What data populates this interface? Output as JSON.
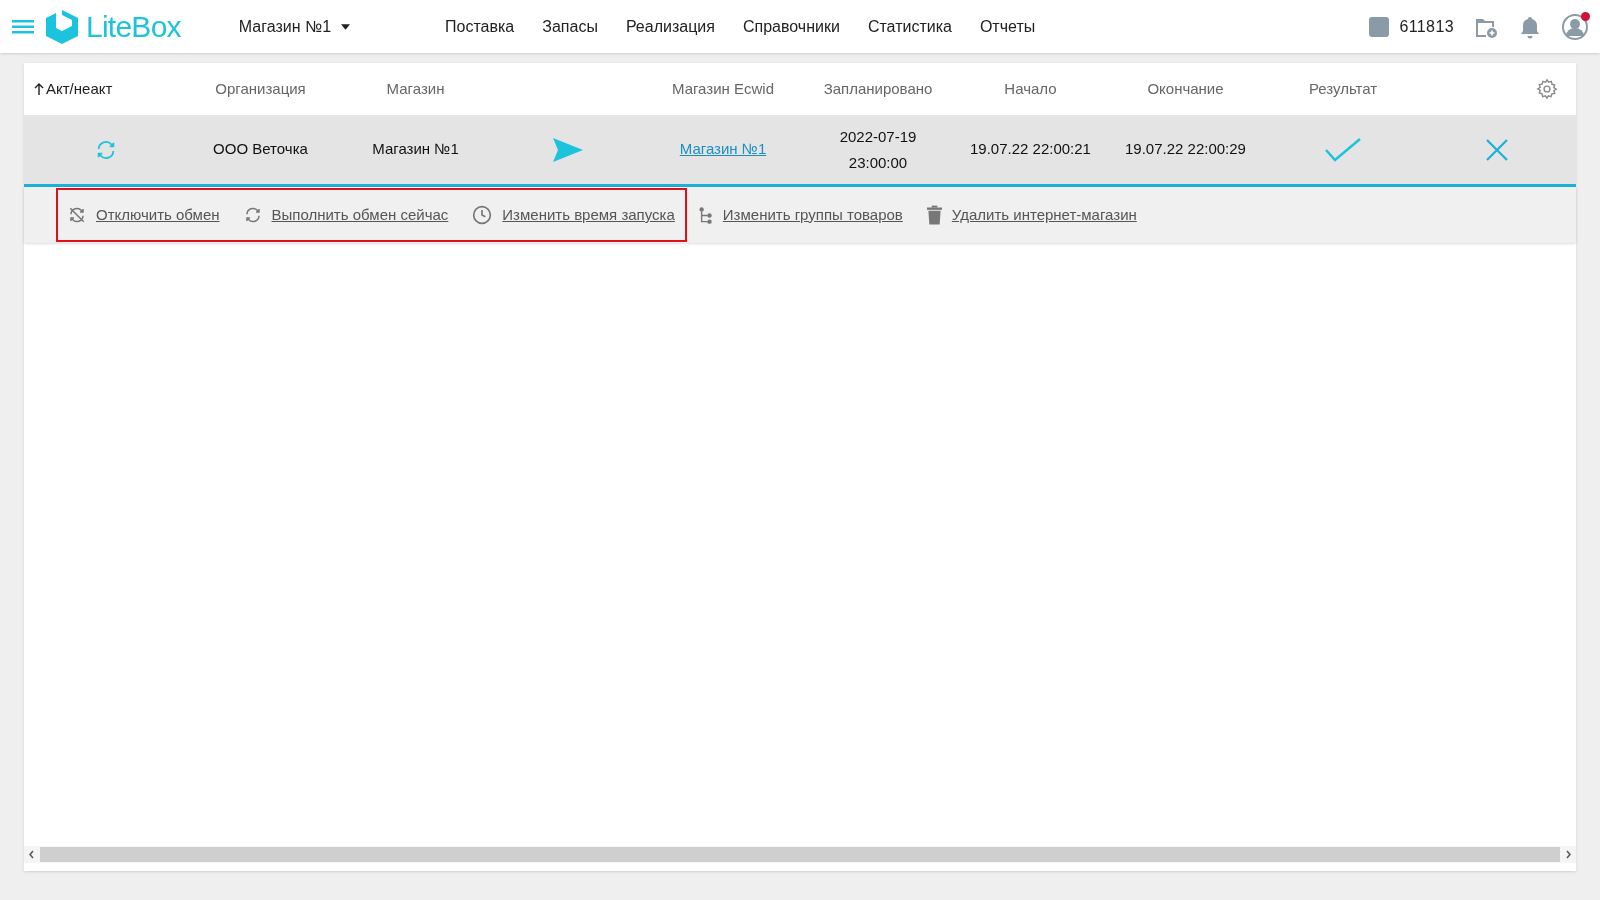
{
  "header": {
    "logo": "LiteBox",
    "store_selector": "Магазин №1",
    "nav": [
      {
        "label": "Поставка"
      },
      {
        "label": "Запасы"
      },
      {
        "label": "Реализация"
      },
      {
        "label": "Справочники"
      },
      {
        "label": "Статистика"
      },
      {
        "label": "Отчеты"
      }
    ],
    "account_id": "611813",
    "notification_dot": true
  },
  "table": {
    "columns": [
      {
        "label": "Акт/неакт",
        "sorted": true
      },
      {
        "label": "Организация",
        "sorted": false
      },
      {
        "label": "Магазин",
        "sorted": false
      },
      {
        "label": "Магазин Ecwid",
        "sorted": false
      },
      {
        "label": "Запланировано",
        "sorted": false
      },
      {
        "label": "Начало",
        "sorted": false
      },
      {
        "label": "Окончание",
        "sorted": false
      },
      {
        "label": "Результат",
        "sorted": false
      }
    ],
    "rows": [
      {
        "active": true,
        "organization": "ООО Веточка",
        "store": "Магазин №1",
        "ecwid_store": "Магазин №1",
        "scheduled_date": "2022-07-19",
        "scheduled_time": "23:00:00",
        "start": "19.07.22 22:00:21",
        "end": "19.07.22 22:00:29",
        "succeeded": true,
        "selected": true
      }
    ]
  },
  "actions": [
    {
      "kind": "disable",
      "label": "Отключить обмен",
      "highlighted": true
    },
    {
      "kind": "run",
      "label": "Выполнить обмен сейчас",
      "highlighted": true
    },
    {
      "kind": "schedule",
      "label": "Изменить время запуска",
      "highlighted": true
    },
    {
      "kind": "groups",
      "label": "Изменить группы товаров",
      "highlighted": false
    },
    {
      "kind": "delete",
      "label": "Удалить интернет-магазин",
      "highlighted": false
    }
  ]
}
